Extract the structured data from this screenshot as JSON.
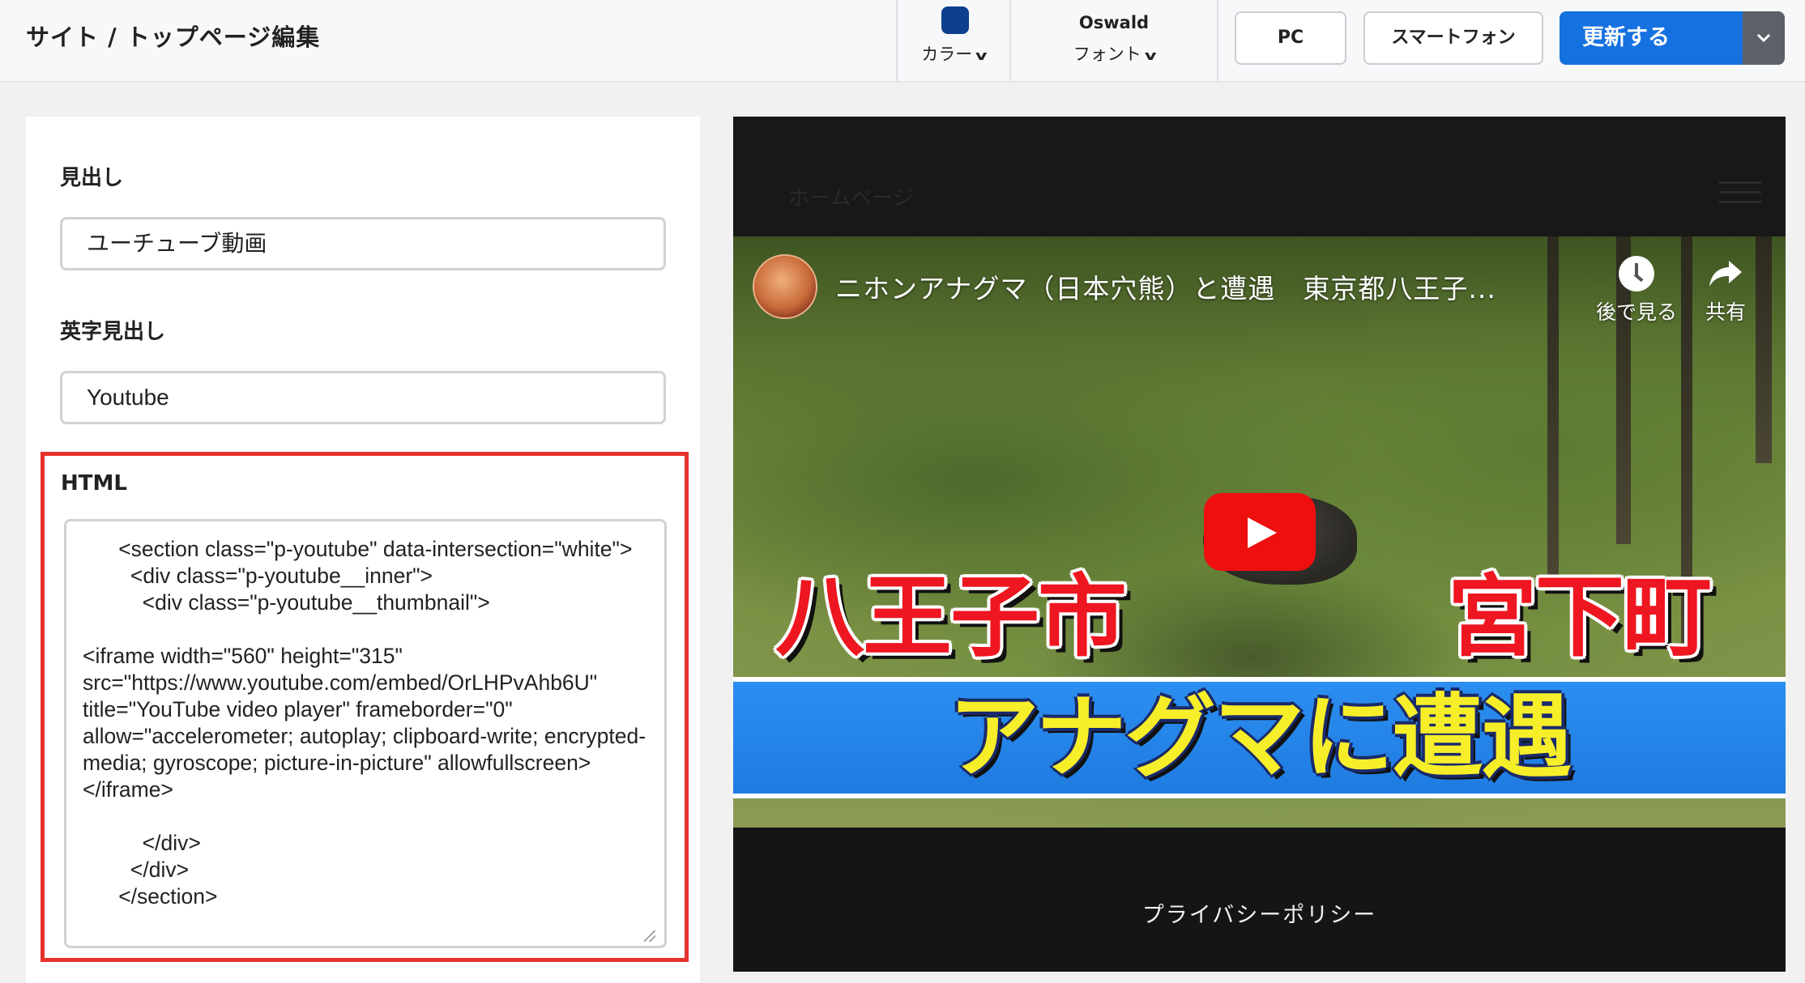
{
  "header": {
    "breadcrumb": "サイト / トップページ編集",
    "color_label": "カラー",
    "color_value": "#0d3f8c",
    "font_name": "Oswald",
    "font_label": "フォント",
    "pc_label": "PC",
    "smartphone_label": "スマートフォン",
    "update_label": "更新する",
    "chevron_glyph": "⌄"
  },
  "editor": {
    "heading_label": "見出し",
    "heading_value": "ユーチューブ動画",
    "en_heading_label": "英字見出し",
    "en_heading_value": "Youtube",
    "html_label": "HTML",
    "html_value": "      <section class=\"p-youtube\" data-intersection=\"white\">\n        <div class=\"p-youtube__inner\">\n          <div class=\"p-youtube__thumbnail\">\n\n<iframe width=\"560\" height=\"315\" src=\"https://www.youtube.com/embed/OrLHPvAhb6U\" title=\"YouTube video player\" frameborder=\"0\" allow=\"accelerometer; autoplay; clipboard-write; encrypted-media; gyroscope; picture-in-picture\" allowfullscreen></iframe>\n\n          </div>\n        </div>\n      </section>"
  },
  "preview": {
    "home_link": "ホームページ",
    "video_title": "ニホンアナグマ（日本穴熊）と遭遇　東京都八王子...",
    "watch_later": "後で見る",
    "share": "共有",
    "caption_left": "八王子市",
    "caption_right": "宮下町",
    "caption_band": "アナグマに遭遇",
    "footer_link": "プライバシーポリシー"
  }
}
